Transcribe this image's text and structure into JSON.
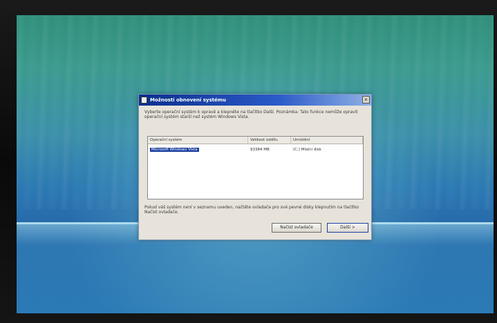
{
  "dialog": {
    "title": "Možnosti obnovení systému",
    "close_glyph": "×",
    "intro": "Vyberte operační systém k opravě a klepněte na tlačítko Další. Poznámka: Tato funkce nemůže opravit operační systém starší než systém Windows Vista.",
    "columns": [
      "Operační systém",
      "Velikost oddílu",
      "Umístění"
    ],
    "rows": [
      {
        "os": "Microsoft Windows Vista",
        "size": "93384 MB",
        "location": "(C:) Místní disk"
      }
    ],
    "note": "Pokud váš systém není v seznamu uveden, načtěte ovladače pro své pevné disky klepnutím na tlačítko Načíst ovladače.",
    "load_drivers_label": "Načíst ovladače",
    "next_label": "Další >"
  }
}
